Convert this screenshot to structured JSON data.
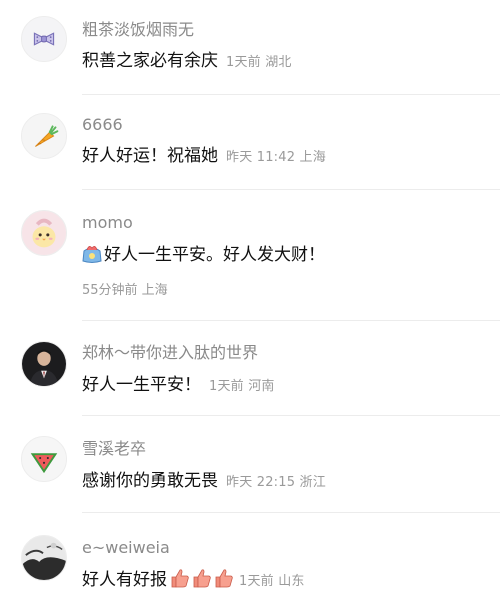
{
  "comments": [
    {
      "username": "粗茶淡饭烟雨无",
      "text": "积善之家必有余庆",
      "meta": "1天前 湖北",
      "avatar_icon": "bow-tie-icon"
    },
    {
      "username": "6666",
      "text": "好人好运！祝福她",
      "meta": "昨天 11:42 上海",
      "avatar_icon": "carrot-icon"
    },
    {
      "username": "momo",
      "text": "好人一生平安。好人发大财！",
      "meta": "55分钟前 上海",
      "avatar_icon": "cartoon-chick-icon",
      "leading_emoji": "lucky-bag-emoji"
    },
    {
      "username": "郑林～带你进入肽的世界",
      "text": "好人一生平安！",
      "meta": "1天前 河南",
      "avatar_icon": "man-in-suit-photo-icon"
    },
    {
      "username": "雪溪老卒",
      "text": "感谢你的勇敢无畏",
      "meta": "昨天 22:15 浙江",
      "avatar_icon": "watermelon-icon"
    },
    {
      "username": "e~weiweia",
      "text": "好人有好报",
      "meta": "1天前 山东",
      "avatar_icon": "ink-landscape-icon",
      "trailing_emoji": [
        "thumbs-up-emoji",
        "thumbs-up-emoji",
        "thumbs-up-emoji"
      ]
    }
  ],
  "colors": {
    "username": "#8a8a8a",
    "text": "#111111",
    "meta": "#9a9a9a",
    "divider": "#ececec"
  }
}
